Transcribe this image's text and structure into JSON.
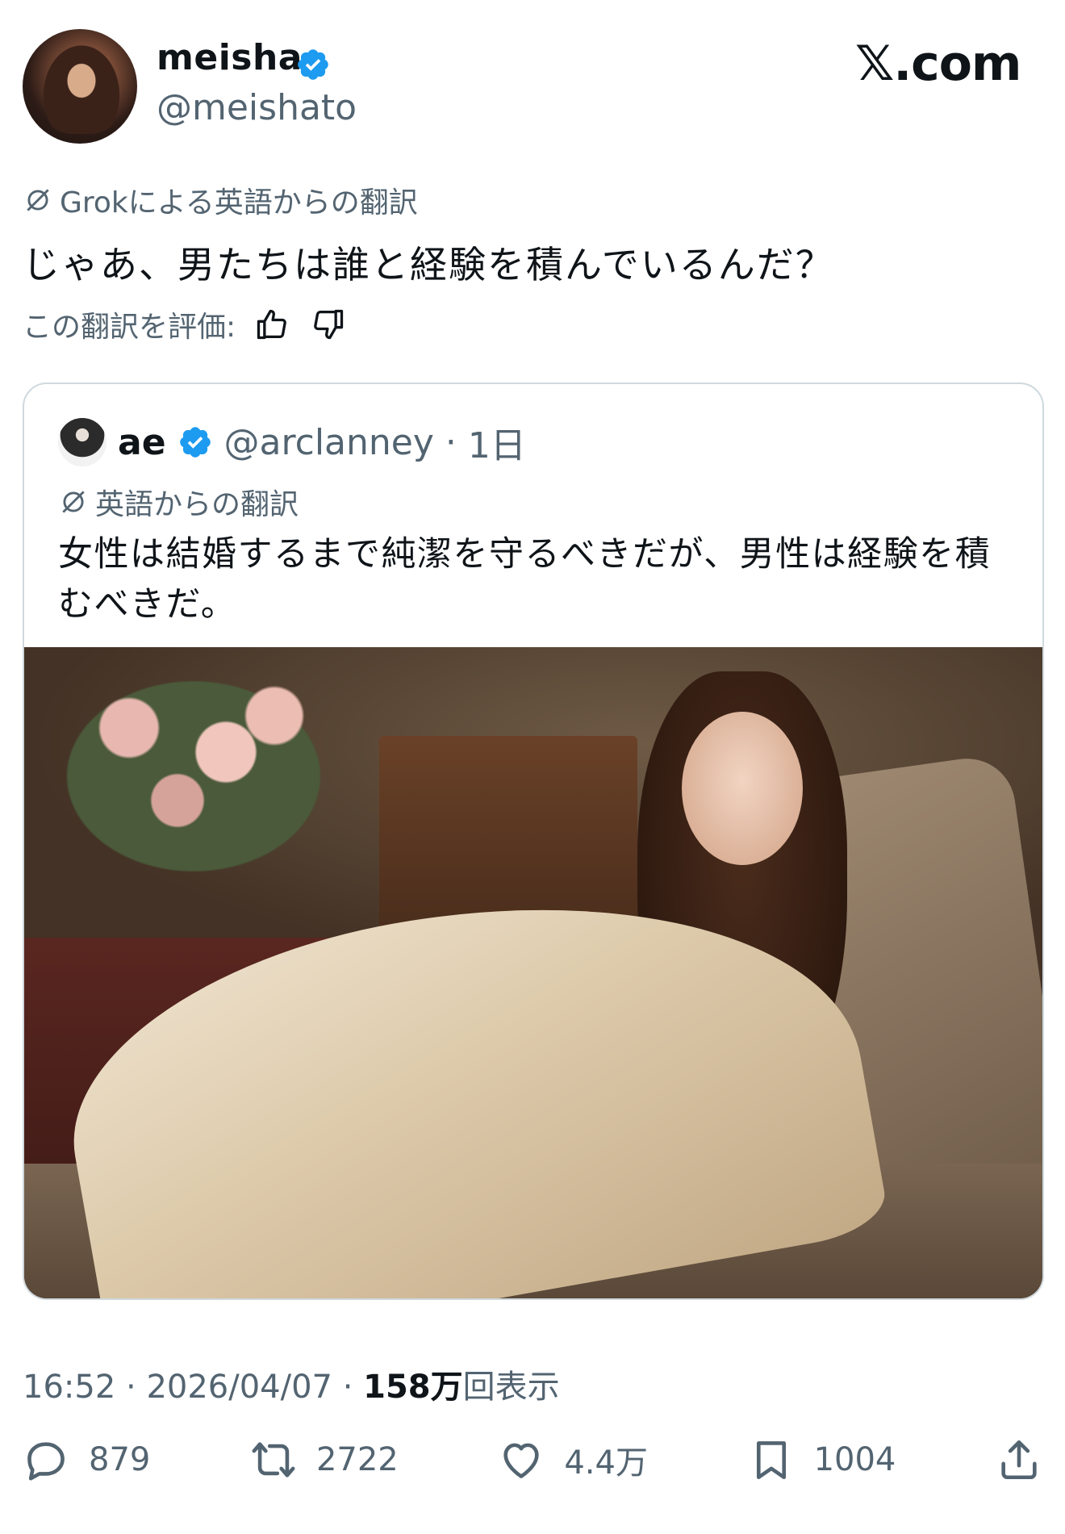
{
  "author": {
    "display_name": "meisha",
    "handle": "@meishato",
    "verified": true
  },
  "brand": {
    "label": "𝕏.com"
  },
  "translation": {
    "label": "Grokによる英語からの翻訳",
    "text": "じゃあ、男たちは誰と経験を積んでいるんだ？",
    "rate_label": "この翻訳を評価:"
  },
  "quoted": {
    "display_name": "ae",
    "handle": "@arclanney",
    "separator": "·",
    "time": "1日",
    "translation_label": "英語からの翻訳",
    "text": "女性は結婚するまで純潔を守るべきだが、男性は経験を積むべきだ。"
  },
  "meta": {
    "time": "16:52",
    "dot1": "·",
    "date": "2026/04/07",
    "dot2": "·",
    "views_count": "158万",
    "views_label": "回表示"
  },
  "stats": {
    "replies": "879",
    "reposts": "2722",
    "likes": "4.4万",
    "bookmarks": "1004"
  },
  "colors": {
    "verified": "#1d9bf0",
    "secondary": "#536471",
    "border": "#cfd9de"
  }
}
